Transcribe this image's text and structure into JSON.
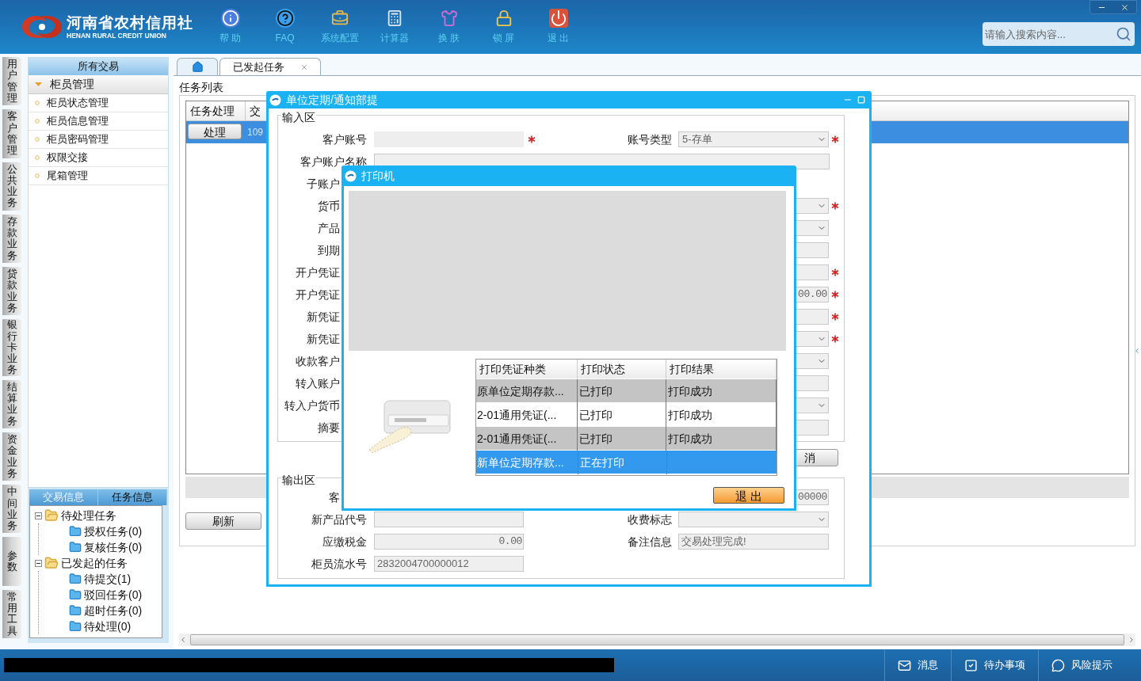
{
  "header": {
    "logo_title": "河南省农村信用社",
    "logo_subtitle": "HENAN RURAL CREDIT UNION",
    "toolbar": [
      {
        "label": "帮 助",
        "kind": "info"
      },
      {
        "label": "FAQ",
        "kind": "faq"
      },
      {
        "label": "系统配置",
        "kind": "config"
      },
      {
        "label": "计算器",
        "kind": "calculator"
      },
      {
        "label": "换 肤",
        "kind": "skin"
      },
      {
        "label": "锁 屏",
        "kind": "lock"
      },
      {
        "label": "退 出",
        "kind": "exit"
      }
    ],
    "search": {
      "placeholder": "请输入搜索内容..."
    }
  },
  "nav_tabs": [
    "用户管理",
    "客户管理",
    "公共业务",
    "存款业务",
    "贷款业务",
    "银行卡业务",
    "结算业务",
    "资金业务",
    "中间业务",
    "参数",
    "常用工具"
  ],
  "sidebar": {
    "title": "所有交易",
    "groups": [
      {
        "label": "柜员管理",
        "expanded": true,
        "items": [
          "柜员状态管理",
          "柜员信息管理",
          "柜员密码管理",
          "权限交接",
          "尾箱管理"
        ]
      }
    ],
    "info_tabs": [
      {
        "label": "交易信息",
        "selected": false
      },
      {
        "label": "任务信息",
        "selected": true
      }
    ],
    "tree": [
      {
        "label": "待处理任务",
        "expanded": true,
        "children": [
          {
            "label": "授权任务(0)"
          },
          {
            "label": "复核任务(0)"
          }
        ]
      },
      {
        "label": "已发起的任务",
        "expanded": true,
        "children": [
          {
            "label": "待提交(1)"
          },
          {
            "label": "驳回任务(0)"
          },
          {
            "label": "超时任务(0)"
          },
          {
            "label": "待处理(0)"
          }
        ]
      }
    ]
  },
  "tabs": [
    {
      "kind": "home",
      "selected": false
    },
    {
      "kind": "page",
      "label": "已发起任务",
      "selected": true
    }
  ],
  "task_list": {
    "legend": "任务列表",
    "columns": [
      "任务处理",
      "交"
    ],
    "rows": [
      {
        "action": "处理",
        "column_2": "109",
        "selected": true
      }
    ],
    "refresh_button": "刷新"
  },
  "dialog": {
    "title": "单位定期/通知部提",
    "input_area": {
      "legend": "输入区",
      "rows": [
        {
          "kind": "full",
          "label": "客户账号",
          "left": {
            "kind": "text",
            "required": true
          },
          "right": {
            "label": "账号类型",
            "kind": "select",
            "value": "5-存单",
            "required": true
          }
        },
        {
          "kind": "wide",
          "label": "客户账户名称"
        },
        {
          "kind": "cut",
          "label": "子账户"
        },
        {
          "kind": "cut",
          "label": "货币",
          "right": {
            "kind": "select",
            "required": true
          }
        },
        {
          "kind": "cut",
          "label": "产品",
          "right": {
            "kind": "select",
            "required": false
          }
        },
        {
          "kind": "cut",
          "label": "到期",
          "right": {
            "kind": "text",
            "required": false
          }
        },
        {
          "kind": "cut",
          "label": "开户凭证",
          "right": {
            "kind": "text",
            "required": true
          }
        },
        {
          "kind": "cut",
          "label": "开户凭证",
          "right": {
            "kind": "amount",
            "value": "00.00",
            "required": true
          }
        },
        {
          "kind": "cut",
          "label": "新凭证",
          "right": {
            "kind": "text",
            "required": true
          }
        },
        {
          "kind": "cut",
          "label": "新凭证",
          "right": {
            "kind": "select",
            "required": true
          }
        },
        {
          "kind": "cut",
          "label": "收款客户",
          "right": {
            "kind": "select",
            "required": false
          }
        },
        {
          "kind": "cut",
          "label": "转入账户",
          "right": {
            "kind": "text",
            "required": false
          }
        },
        {
          "kind": "cut",
          "label": "转入户货币",
          "right": {
            "kind": "select",
            "required": false
          }
        },
        {
          "kind": "cut",
          "label": "摘要",
          "right": {
            "kind": "text",
            "required": false
          }
        }
      ]
    },
    "cancel_button": "消",
    "output_area": {
      "legend": "输出区",
      "rows": [
        {
          "kind": "cut",
          "label": "客",
          "right": {
            "kind": "amount",
            "value": "00000",
            "required": false
          }
        },
        {
          "kind": "full",
          "label": "新产品代号",
          "left": {
            "kind": "text",
            "required": false
          },
          "right": {
            "label": "收费标志",
            "kind": "select",
            "required": false
          }
        },
        {
          "kind": "full",
          "label": "应缴税金",
          "left": {
            "kind": "amount",
            "value": "0.00",
            "required": false
          },
          "right": {
            "label": "备注信息",
            "kind": "text",
            "value": "交易处理完成!",
            "required": false
          }
        },
        {
          "kind": "full",
          "label": "柜员流水号",
          "left": {
            "kind": "text",
            "value": "2832004700000012",
            "required": false
          }
        }
      ]
    }
  },
  "printer_dialog": {
    "title": "打印机",
    "columns": [
      "打印凭证种类",
      "打印状态",
      "打印结果"
    ],
    "rows": [
      {
        "cells": [
          "原单位定期存款...",
          "已打印",
          "打印成功"
        ],
        "selected": false
      },
      {
        "cells": [
          "2-01通用凭证(...",
          "已打印",
          "打印成功"
        ],
        "selected": false
      },
      {
        "cells": [
          "2-01通用凭证(...",
          "已打印",
          "打印成功"
        ],
        "selected": false
      },
      {
        "cells": [
          "新单位定期存款...",
          "正在打印"
        ],
        "selected": true
      }
    ],
    "exit_button": "退 出"
  },
  "status_bar": {
    "items": [
      {
        "kind": "message",
        "label": "消息"
      },
      {
        "kind": "todo",
        "label": "待办事项"
      },
      {
        "kind": "risk",
        "label": "风险提示"
      }
    ]
  }
}
